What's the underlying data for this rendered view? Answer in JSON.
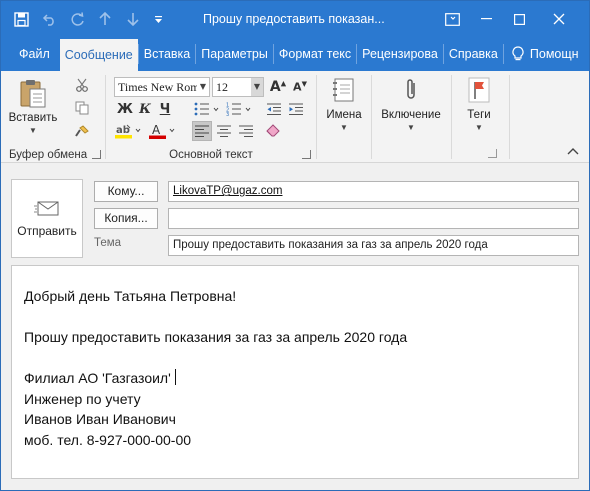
{
  "titlebar": {
    "title": "Прошу предоставить показан...",
    "qat_icons": [
      "save-icon",
      "undo-icon",
      "redo-icon",
      "up-arrow-icon",
      "down-arrow-icon",
      "customize-qat-icon"
    ],
    "restore_icon": "restore-window-icon",
    "minimize_icon": "minimize-icon",
    "maximize_icon": "maximize-icon",
    "close_icon": "close-icon"
  },
  "tabs": [
    {
      "label": "Файл"
    },
    {
      "label": "Сообщение",
      "active": true
    },
    {
      "label": "Вставка"
    },
    {
      "label": "Параметры"
    },
    {
      "label": "Формат текс"
    },
    {
      "label": "Рецензирова"
    },
    {
      "label": "Справка"
    },
    {
      "label": "Помощн"
    }
  ],
  "ribbon": {
    "clipboard": {
      "paste_label": "Вставить",
      "group_label": "Буфер обмена"
    },
    "basic_text": {
      "font_name": "Times New Roma",
      "font_size": "12",
      "group_label": "Основной текст",
      "highlight_color": "#ffe400",
      "font_color": "#d40000"
    },
    "names_label": "Имена",
    "include_label": "Включение",
    "tags_label": "Теги",
    "flag_color": "#e2533c"
  },
  "header": {
    "send_label": "Отправить",
    "to_button": "Кому...",
    "to_value": "LikovaTP@ugaz.com",
    "cc_button": "Копия...",
    "cc_value": "",
    "subject_label": "Тема",
    "subject_value": "Прошу предоставить показания за газ за апрель 2020 года"
  },
  "body": {
    "greeting": "Добрый день Татьяна Петровна!",
    "request": "Прошу предоставить показания за газ за апрель 2020 года",
    "sig_org": "Филиал АО 'Газгазоил'",
    "sig_position": "Инженер по учету",
    "sig_name": "Иванов Иван Иванович",
    "sig_phone": "моб. тел. 8-927-000-00-00"
  },
  "colors": {
    "accent": "#2b79d0"
  }
}
